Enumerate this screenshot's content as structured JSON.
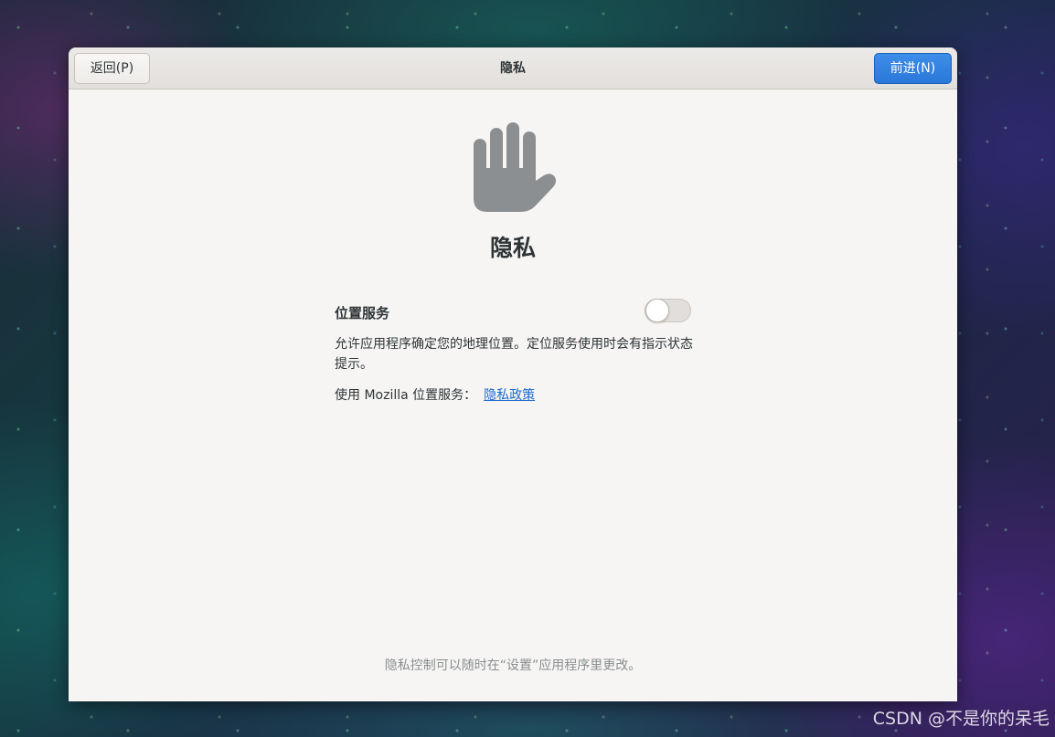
{
  "header": {
    "back_label": "返回(P)",
    "title": "隐私",
    "next_label": "前进(N)"
  },
  "page": {
    "icon": "hand-stop-icon",
    "title": "隐私"
  },
  "location": {
    "label": "位置服务",
    "enabled": false,
    "description": "允许应用程序确定您的地理位置。定位服务使用时会有指示状态提示。",
    "mozilla_text": "使用 Mozilla 位置服务：",
    "policy_link": "隐私政策"
  },
  "footer": {
    "note": "隐私控制可以随时在“设置”应用程序里更改。"
  },
  "watermark": "CSDN @不是你的呆毛",
  "colors": {
    "accent": "#2a78da",
    "link": "#1b6acb",
    "text": "#2e3436",
    "window_bg": "#f6f5f4"
  }
}
